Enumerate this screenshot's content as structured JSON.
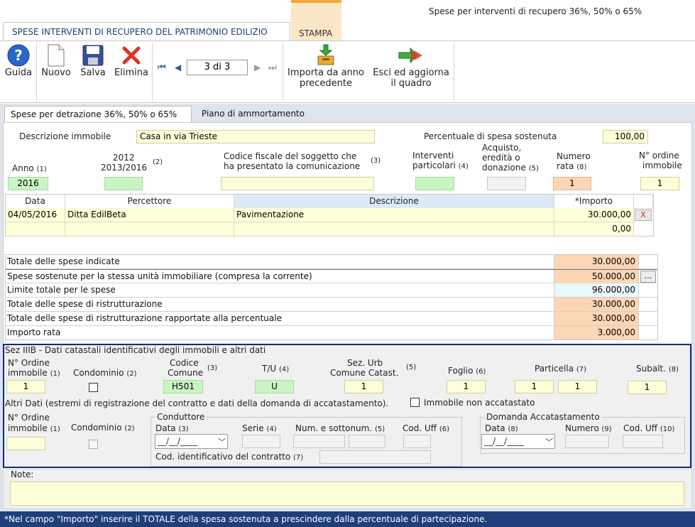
{
  "window": {
    "title": "Spese per interventi di recupero 36%, 50% o 65%"
  },
  "tabs": {
    "main": "SPESE INTERVENTI DI RECUPERO DEL PATRIMONIO EDILIZIO",
    "print": "STAMPA"
  },
  "toolbar": {
    "help": "Guida",
    "new": "Nuovo",
    "save": "Salva",
    "delete": "Elimina",
    "record": "3 di 3",
    "import_l1": "Importa da anno",
    "import_l2": "precedente",
    "exit_l1": "Esci ed aggiorna",
    "exit_l2": "il quadro"
  },
  "subtabs": {
    "active": "Spese per detrazione 36%, 50% o 65%",
    "other": "Piano di ammortamento"
  },
  "form": {
    "descr_label": "Descrizione immobile",
    "descr_value": "Casa in via Trieste",
    "perc_label": "Percentuale di spesa sostenuta",
    "perc_value": "100,00",
    "anno_label": "Anno",
    "anno_n": "(1)",
    "anno_value": "2016",
    "y2012": "2012",
    "y2013": "2013/2016",
    "y_n": "(2)",
    "cf_l1": "Codice fiscale del soggetto che",
    "cf_l2": "ha presentato la comunicazione",
    "cf_n": "(3)",
    "int_l1": "Interventi",
    "int_l2": "particolari",
    "int_n": "(4)",
    "acq_l1": "Acquisto,",
    "acq_l2": "eredità o",
    "acq_l3": "donazione",
    "acq_n": "(5)",
    "rata_l1": "Numero",
    "rata_l2": "rata",
    "rata_n": "(8)",
    "rata_value": "1",
    "ord_l1": "N° ordine",
    "ord_l2": "immobile",
    "ord_value": "1"
  },
  "grid": {
    "headers": [
      "Data",
      "Percettore",
      "Descrizione",
      "*Importo"
    ],
    "rows": [
      {
        "data": "04/05/2016",
        "percettore": "Ditta EdilBeta",
        "descrizione": "Pavimentazione",
        "importo": "30.000,00",
        "del": "X"
      },
      {
        "data": "",
        "percettore": "",
        "descrizione": "",
        "importo": "0,00"
      }
    ]
  },
  "totals": [
    {
      "label": "Totale delle spese indicate",
      "value": "30.000,00"
    },
    {
      "label": "Spese sostenute per la stessa unità immobiliare (compresa la corrente)",
      "value": "50.000,00",
      "btn": "..."
    },
    {
      "label": "Limite totale per le spese",
      "value": "96.000,00"
    },
    {
      "label": "Totale delle spese di ristrutturazione",
      "value": "30.000,00"
    },
    {
      "label": "Totale delle spese di ristrutturazione rapportate alla percentuale",
      "value": "30.000,00"
    },
    {
      "label": "Importo rata",
      "value": "3.000,00"
    }
  ],
  "sez": {
    "title": "Sez IIIB - Dati catastali identificativi degli immobili e altri dati",
    "ord_l1": "N° Ordine",
    "ord_l2": "immobile",
    "ord_n": "(1)",
    "ord_value": "1",
    "cond_label": "Condominio",
    "cond_n": "(2)",
    "cc_l1": "Codice",
    "cc_l2": "Comune",
    "cc_n": "(3)",
    "cc_value": "H501",
    "tu_label": "T/U",
    "tu_n": "(4)",
    "tu_value": "U",
    "sez_l1": "Sez. Urb",
    "sez_l2": "Comune Catast.",
    "sez_n": "(5)",
    "sez_value": "1",
    "foglio_label": "Foglio",
    "foglio_n": "(6)",
    "foglio_value": "1",
    "part_label": "Particella",
    "part_n": "(7)",
    "part_v1": "1",
    "part_v2": "1",
    "sub_label": "Subalt.",
    "sub_n": "(8)",
    "sub_value": "1",
    "altri": "Altri Dati (estremi di registrazione del contratto e dati della domanda di accatastamento).",
    "non_acc": "Immobile non accatastato",
    "ord2_l1": "N° Ordine",
    "ord2_l2": "immobile",
    "ord2_n": "(1)",
    "cond2_label": "Condominio",
    "cond2_n": "(2)",
    "conduttore": "Conduttore",
    "c_data": "Data",
    "c_data_n": "(3)",
    "c_date_ph": "__/__/____",
    "c_serie": "Serie",
    "c_serie_n": "(4)",
    "c_num": "Num. e sottonum.",
    "c_num_n": "(5)",
    "c_uff": "Cod. Uff",
    "c_uff_n": "(6)",
    "c_cod": "Cod. identificativo del contratto",
    "c_cod_n": "(7)",
    "domanda": "Domanda Accatastamento",
    "d_data": "Data",
    "d_data_n": "(8)",
    "d_numero": "Numero",
    "d_numero_n": "(9)",
    "d_uff": "Cod. Uff",
    "d_uff_n": "(10)"
  },
  "note_label": "Note:",
  "footer": "*Nel campo \"Importo\" inserire il TOTALE della spesa sostenuta a prescindere dalla percentuale di partecipazione."
}
